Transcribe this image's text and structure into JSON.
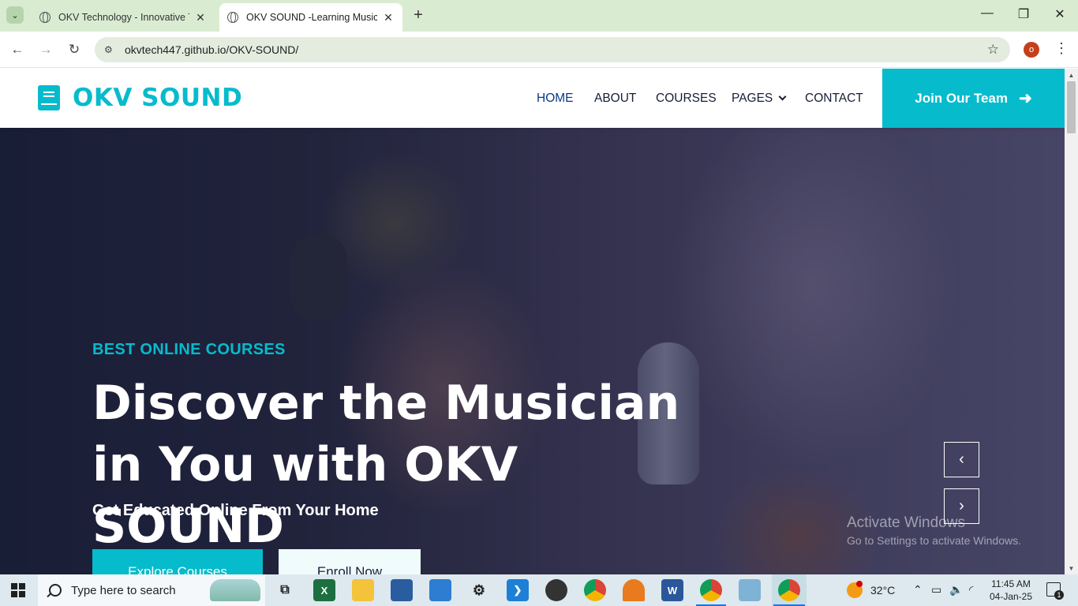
{
  "browser": {
    "tabs": [
      {
        "title": "OKV Technology - Innovative Te",
        "active": false
      },
      {
        "title": "OKV SOUND -Learning Music",
        "active": true
      }
    ],
    "new_tab_label": "+",
    "url": "okvtech447.github.io/OKV-SOUND/",
    "profile_initial": "o",
    "window_controls": {
      "minimize": "—",
      "restore": "❐",
      "close": "✕"
    }
  },
  "site": {
    "brand": "OKV SOUND",
    "menu": [
      {
        "label": "HOME",
        "active": true
      },
      {
        "label": "ABOUT",
        "active": false
      },
      {
        "label": "COURSES",
        "active": false
      },
      {
        "label": "PAGES",
        "active": false,
        "dropdown": true
      },
      {
        "label": "CONTACT",
        "active": false
      }
    ],
    "cta": {
      "label": "Join Our Team",
      "icon": "arrow-right-icon"
    },
    "colors": {
      "primary": "#06bbcc",
      "dark": "#181d38",
      "active_nav": "#06398a"
    }
  },
  "hero": {
    "subtitle": "BEST ONLINE COURSES",
    "title": "Discover the Musician in You with OKV SOUND",
    "tagline": "Get Educated Online From Your Home",
    "buttons": {
      "explore": "Explore Courses",
      "enroll": "Enroll Now"
    },
    "carousel": {
      "prev": "‹",
      "next": "›"
    }
  },
  "watermark": {
    "line1": "Activate Windows",
    "line2": "Go to Settings to activate Windows."
  },
  "taskbar": {
    "search_placeholder": "Type here to search",
    "apps": [
      "task-view",
      "excel",
      "file-explorer",
      "remote-desktop",
      "microsoft-store",
      "settings",
      "vs-code",
      "obs",
      "chrome",
      "app-sun",
      "word",
      "chrome-profile",
      "notepad",
      "chrome-active"
    ],
    "weather": {
      "temp": "32°C",
      "badge": "1"
    },
    "time": "11:45 AM",
    "date": "04-Jan-25",
    "notifications": "1"
  }
}
